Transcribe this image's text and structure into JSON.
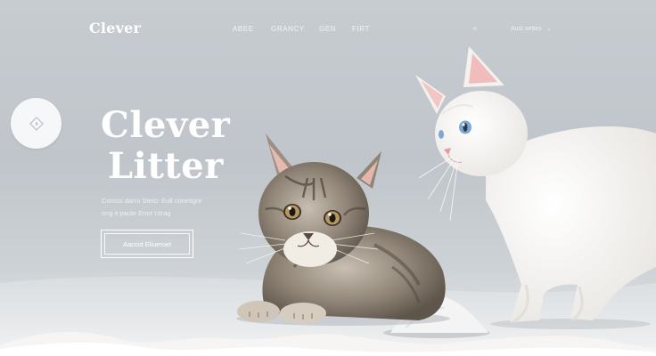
{
  "brand": {
    "logo": "Clever"
  },
  "nav": {
    "links": [
      {
        "label": "ABEE"
      },
      {
        "label": "GRANCY"
      },
      {
        "label": "GEN"
      },
      {
        "label": "FIRT"
      }
    ],
    "close_symbol": "×",
    "account_label": "Aust settes"
  },
  "hero": {
    "title_line1": "Clever",
    "title_line2": "Litter",
    "subtitle_line1": "Coross darro Steto: Eull conetigre",
    "subtitle_line2": "ong it paute Enor Utrag",
    "cta_label": "Aaccid Eliueroel"
  },
  "icons": {
    "play_button": "diamond-play-icon",
    "account_dropdown": "chevron-down-icon"
  },
  "colors": {
    "background": "#c3c9ce",
    "text_primary": "#ffffff",
    "ground": "#e9ebec",
    "tabby_fur": "#8f8476",
    "white_cat": "#f7f5f2",
    "cat_eye_blue": "#7fa7d6"
  }
}
